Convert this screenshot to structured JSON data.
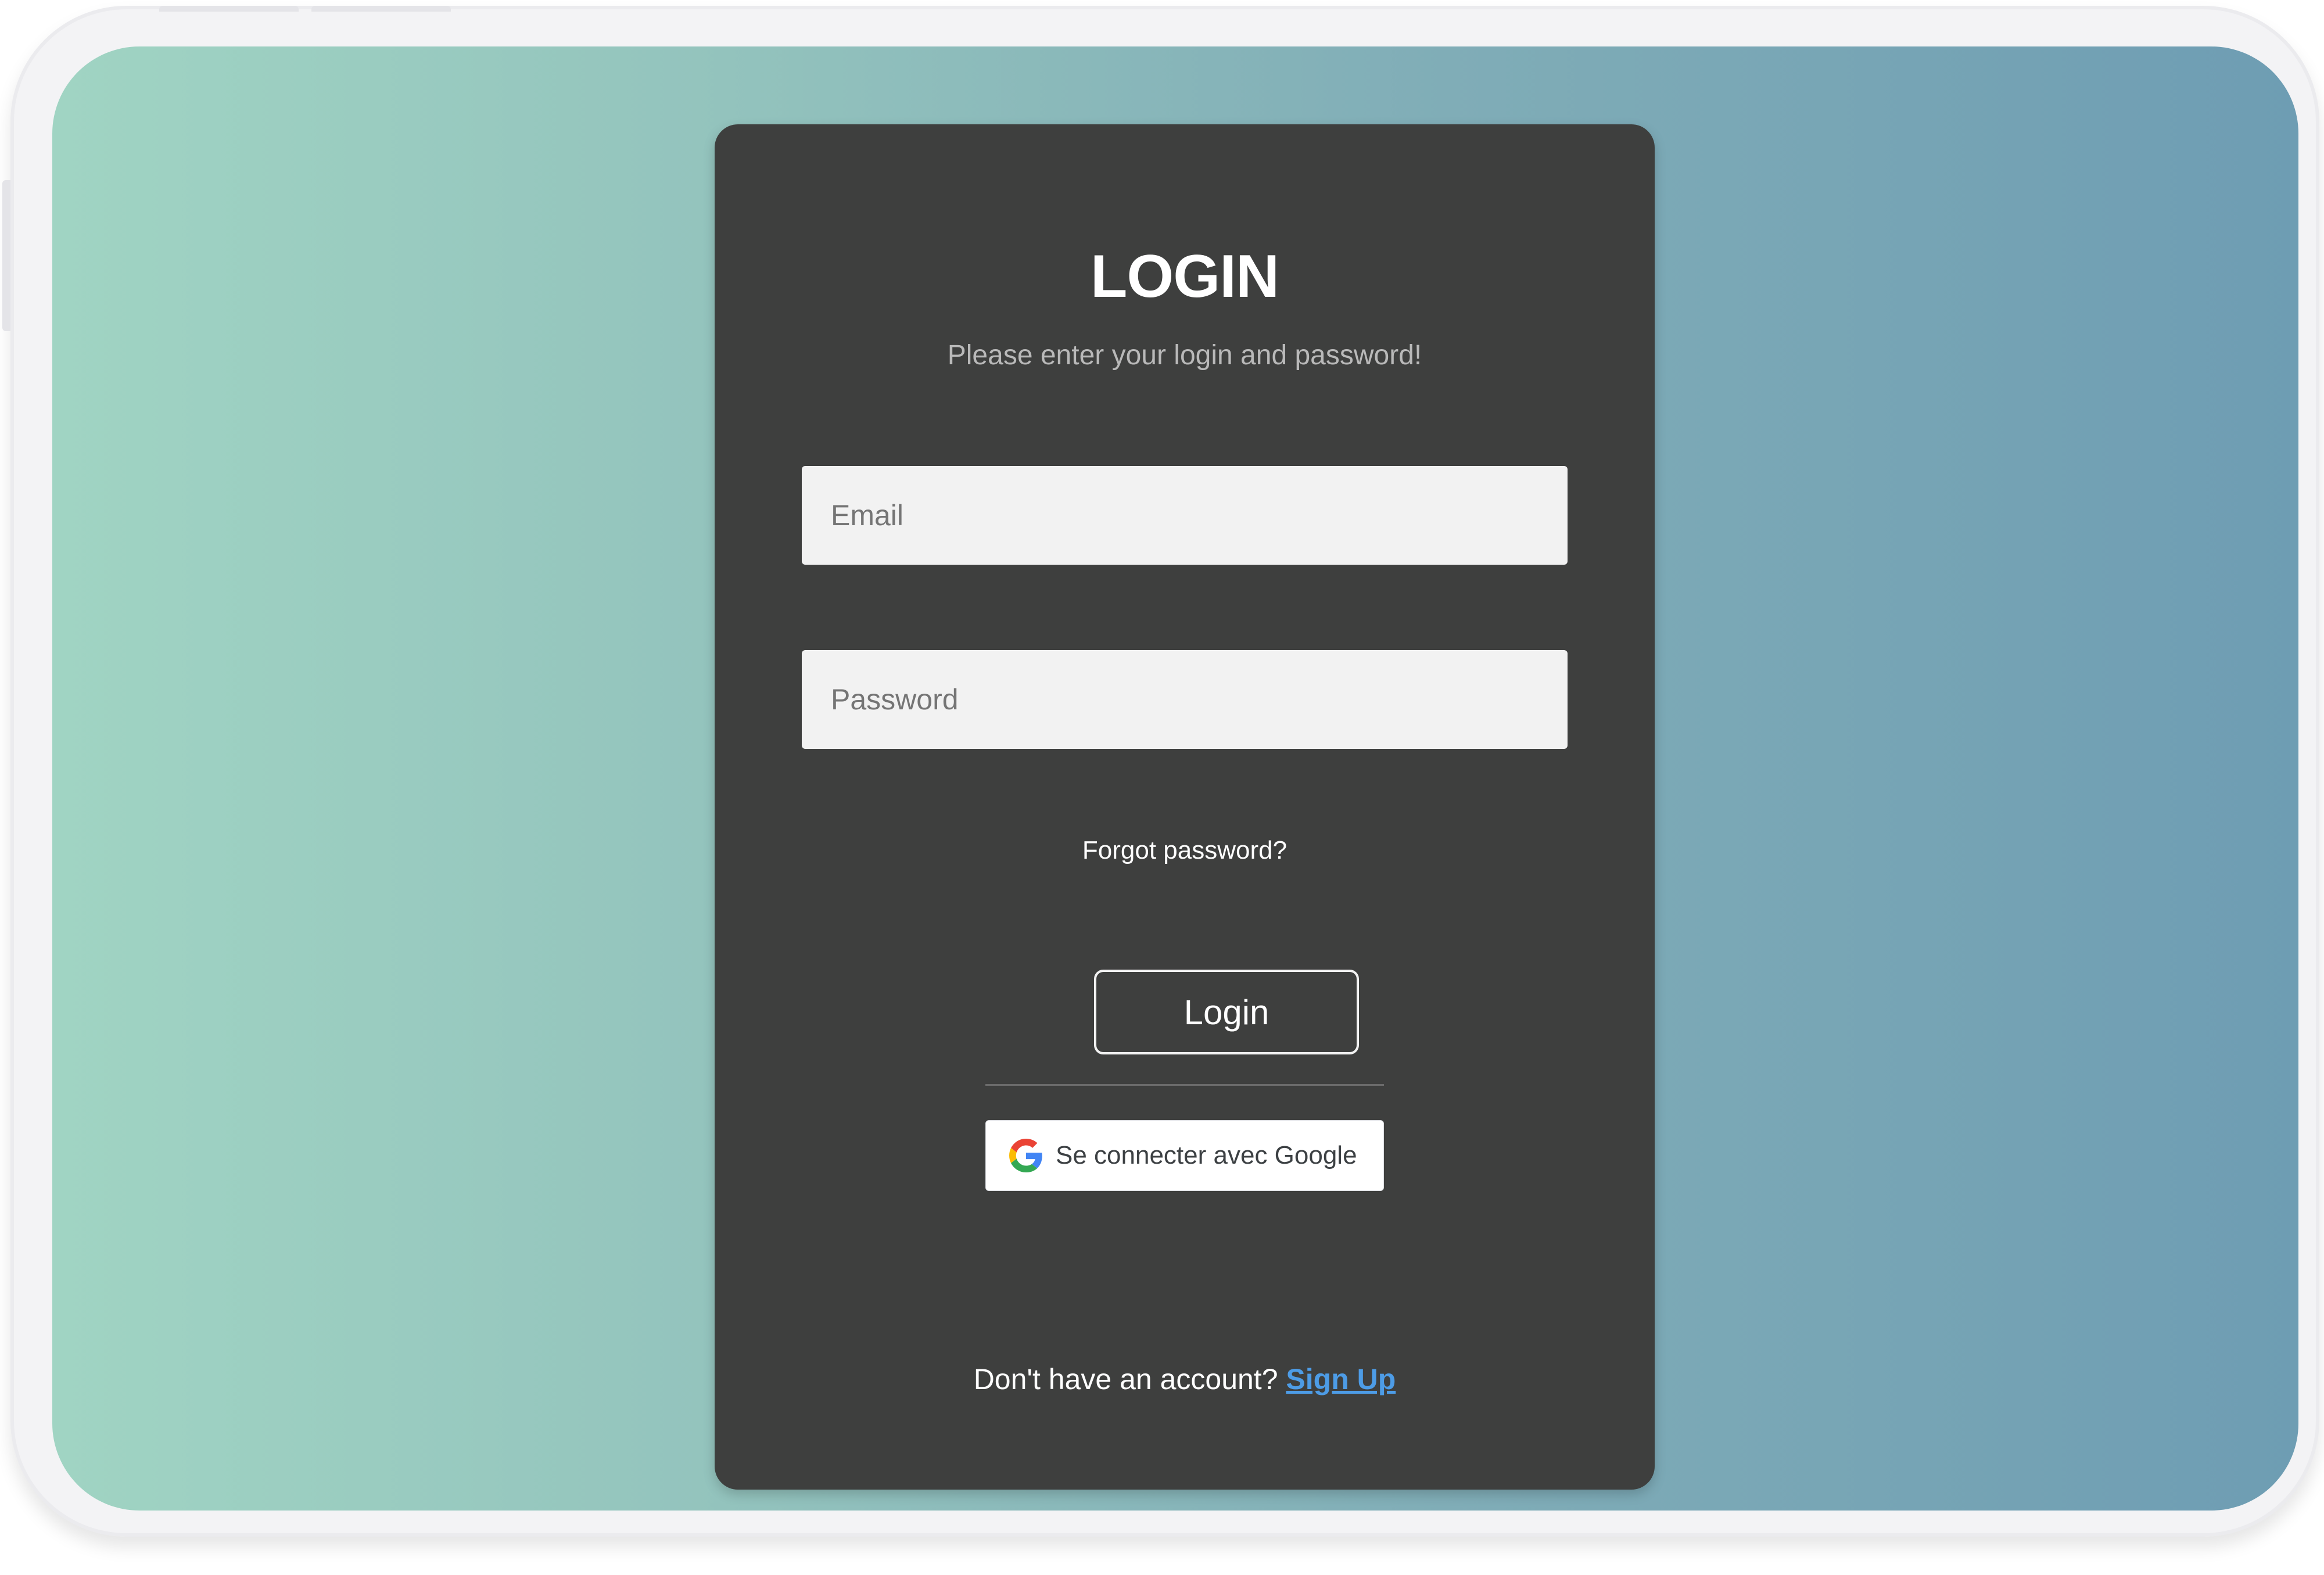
{
  "card": {
    "title": "LOGIN",
    "subtitle": "Please enter your login and password!"
  },
  "form": {
    "email_placeholder": "Email",
    "password_placeholder": "Password",
    "forgot_label": "Forgot password?",
    "login_label": "Login"
  },
  "google": {
    "label": "Se connecter avec Google",
    "icon": "google-g-icon"
  },
  "signup": {
    "prompt": "Don't have an account?",
    "link_label": "Sign Up"
  },
  "colors": {
    "gradient_start": "#a0d4c3",
    "gradient_end": "#6e9db3",
    "card_bg": "#3e3f3e",
    "link": "#4d9ce6"
  }
}
